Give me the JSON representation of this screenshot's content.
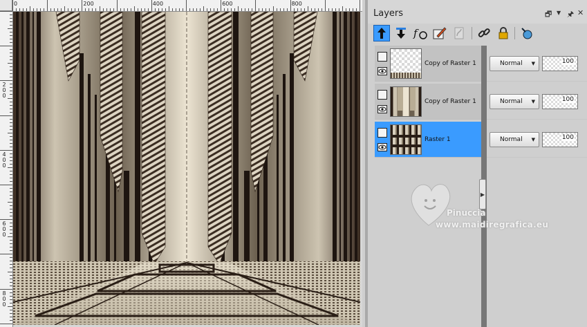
{
  "rulers": {
    "top_labels": [
      "0",
      "200",
      "400",
      "600",
      "800"
    ],
    "left_labels": [
      "200",
      "400",
      "600",
      "800"
    ]
  },
  "panel": {
    "title": "Layers",
    "header_buttons": [
      "restore-icon",
      "dropdown-icon",
      "pin-icon",
      "close-icon"
    ]
  },
  "toolbar": [
    {
      "name": "move-layer-up-icon",
      "active": true
    },
    {
      "name": "move-layer-down-icon",
      "active": false
    },
    {
      "name": "layer-styles-fx-icon",
      "active": false
    },
    {
      "name": "edit-selection-icon",
      "active": false
    },
    {
      "name": "mask-icon",
      "active": false
    },
    {
      "name": "link-layer-icon",
      "active": false
    },
    {
      "name": "lock-icon",
      "active": false
    },
    {
      "name": "new-layer-icon",
      "active": false
    }
  ],
  "layers": [
    {
      "name": "Copy of Raster 1",
      "blend_mode": "Normal",
      "opacity": "100",
      "selected": false,
      "thumb": "transparent-with-floor"
    },
    {
      "name": "Copy of Raster 1",
      "blend_mode": "Normal",
      "opacity": "100",
      "selected": false,
      "thumb": "curtains"
    },
    {
      "name": "Raster 1",
      "blend_mode": "Normal",
      "opacity": "100",
      "selected": true,
      "thumb": "stripes"
    }
  ],
  "watermark": {
    "line1": "Pinuccia",
    "line2": "www.maidiregrafica.eu"
  },
  "colors": {
    "selection": "#3a9bff",
    "tan_light": "#d8cfbd",
    "tan_mid": "#a89e8a",
    "dark_brown": "#2a1e16"
  }
}
